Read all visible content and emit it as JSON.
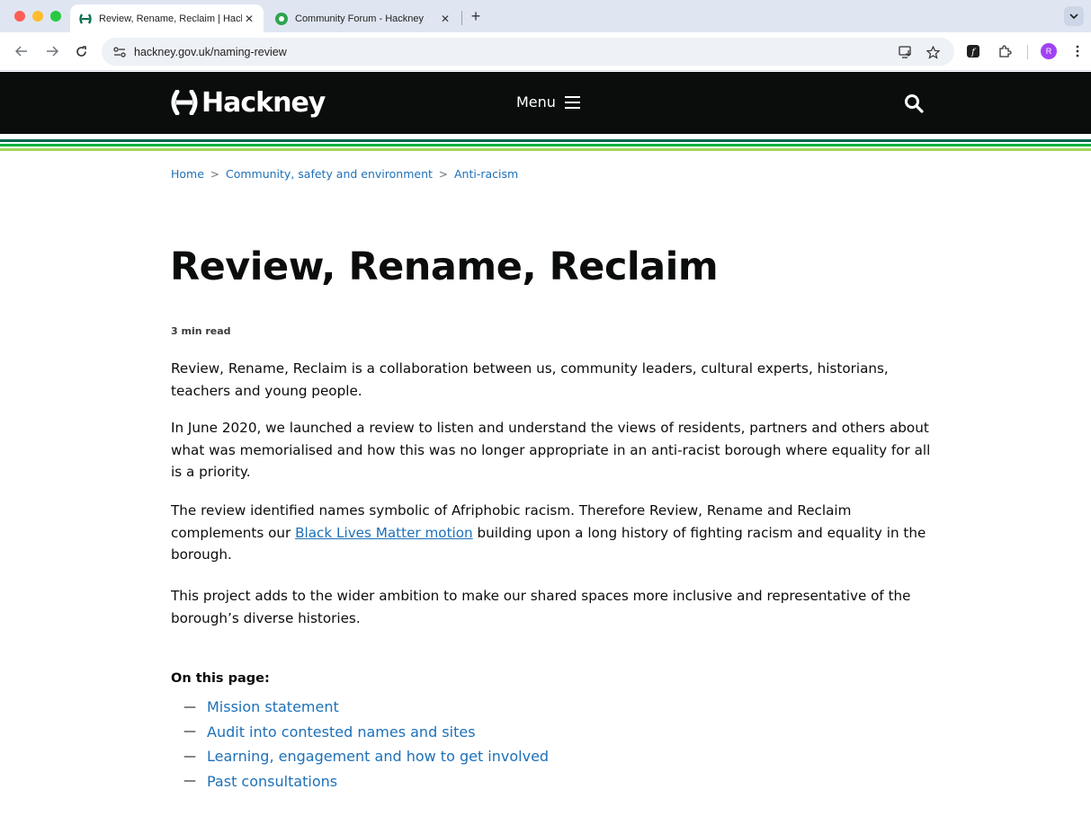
{
  "browser": {
    "tabs": [
      {
        "title": "Review, Rename, Reclaim | Hackney Council",
        "active": true,
        "favicon": "hackney-logo-icon"
      },
      {
        "title": "Community Forum - Hackney",
        "active": false,
        "favicon": "forum-pin-icon"
      }
    ],
    "url": "hackney.gov.uk/naming-review",
    "profile_initial": "R"
  },
  "header": {
    "logo_text": "Hackney",
    "menu_label": "Menu"
  },
  "breadcrumb": [
    "Home",
    "Community, safety and environment",
    "Anti-racism"
  ],
  "page": {
    "title": "Review, Rename, Reclaim",
    "read_time": "3 min read",
    "p1": "Review, Rename, Reclaim is a collaboration between us, community leaders, cultural experts, historians, teachers and young people.",
    "p2": "In June 2020, we launched a review to listen and understand the views of residents, partners and others about what was memorialised and how this was no longer appropriate in an anti-racist borough where equality for all is a priority.",
    "p3_before": "The review identified names symbolic of Afriphobic racism. Therefore Review, Rename and Reclaim complements our ",
    "p3_link": "Black Lives Matter motion",
    "p3_after": " building upon a long history of fighting racism and equality in the borough.",
    "p4": "This project adds to the wider ambition to make our shared spaces more inclusive and representative of the borough’s diverse histories."
  },
  "on_this_page": {
    "heading": "On this page:",
    "dash": "—",
    "items": [
      "Mission statement",
      "Audit into contested names and sites",
      "Learning, engagement and how to get involved",
      "Past consultations"
    ]
  },
  "colors": {
    "header_bg": "#0b0c0c",
    "link": "#1d70b8",
    "stripe_dark_green": "#00664f",
    "stripe_green": "#00b341",
    "stripe_lime": "#a4d65e"
  }
}
